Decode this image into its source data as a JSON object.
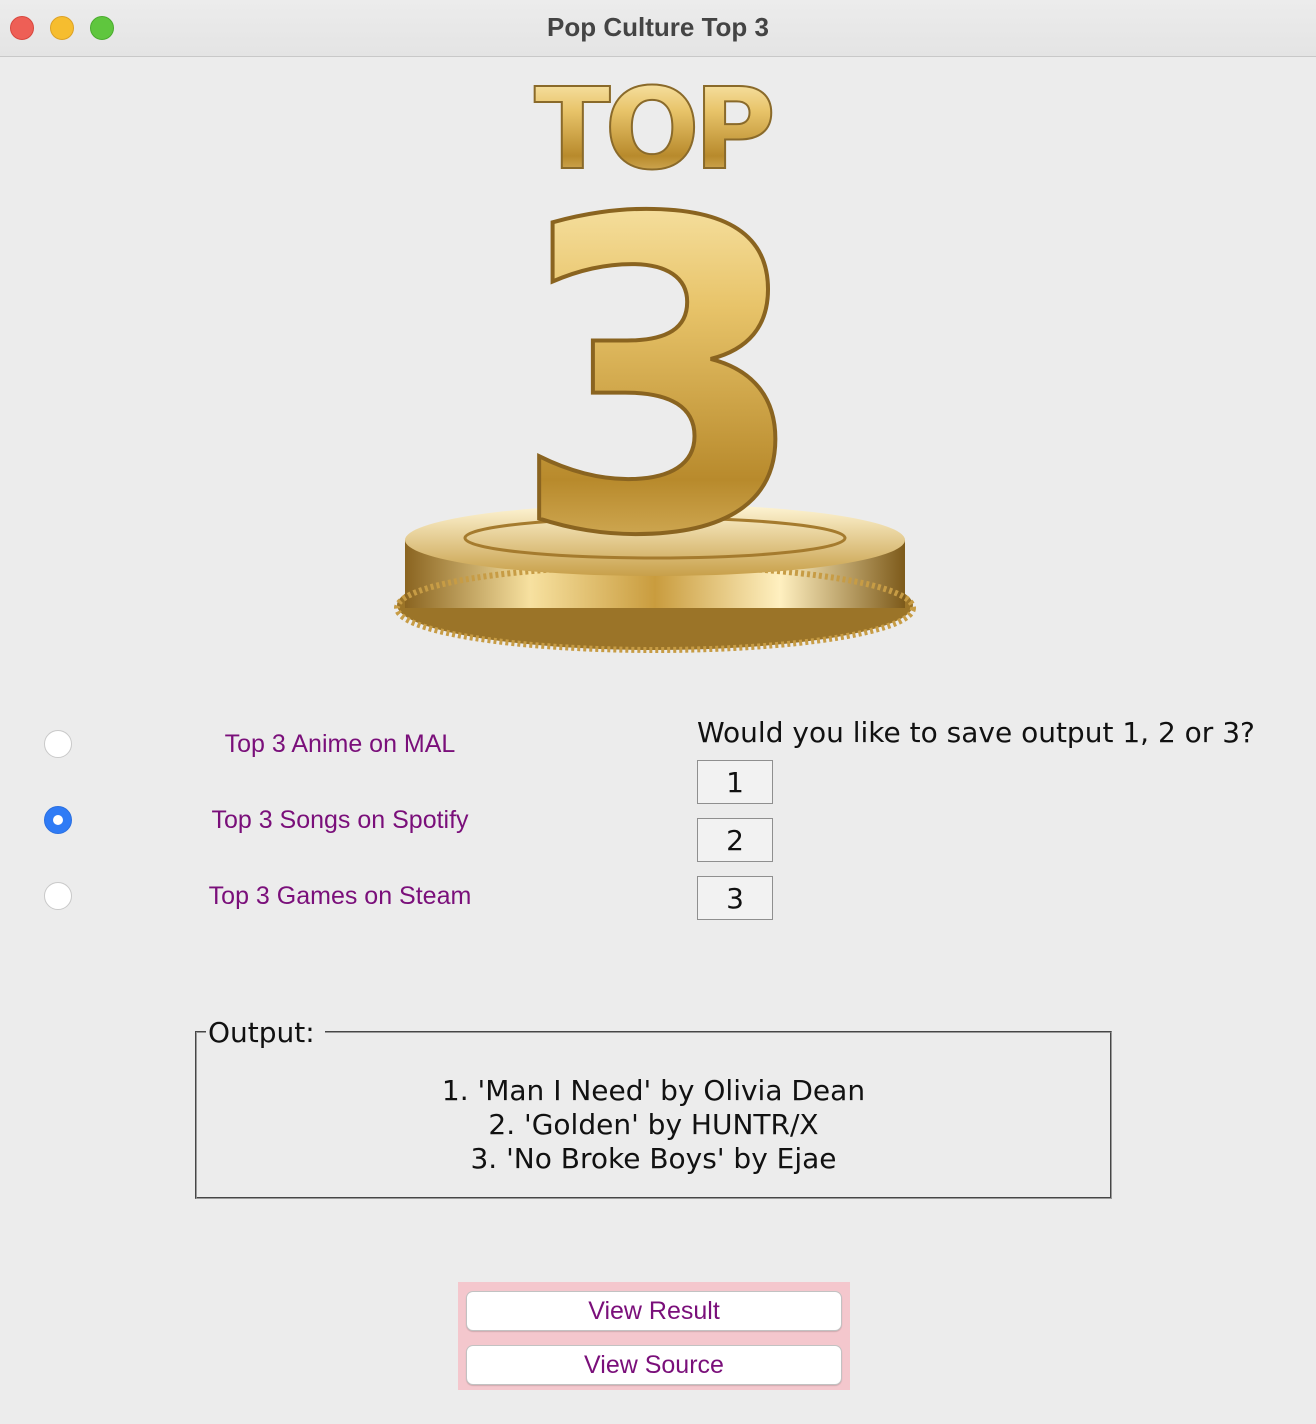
{
  "window": {
    "title": "Pop Culture Top 3",
    "controls": [
      "close",
      "minimize",
      "maximize"
    ]
  },
  "logo": {
    "icon": "gold-top-3-trophy-logo",
    "text_top": "TOP",
    "text_number": "3"
  },
  "categories": {
    "selected_index": 1,
    "items": [
      {
        "label": "Top 3 Anime on MAL",
        "checked": false
      },
      {
        "label": "Top 3 Songs on Spotify",
        "checked": true
      },
      {
        "label": "Top 3 Games on Steam",
        "checked": false
      }
    ]
  },
  "save": {
    "question": "Would you like to save output 1, 2 or 3?",
    "buttons": [
      "1",
      "2",
      "3"
    ]
  },
  "output": {
    "legend": "Output:",
    "lines": [
      "1. 'Man I Need' by Olivia Dean",
      "2. 'Golden' by HUNTR/X",
      "3. 'No Broke Boys' by Ejae"
    ]
  },
  "actions": {
    "view_result": "View Result",
    "view_source": "View Source"
  },
  "colors": {
    "label_purple": "#7a0f7a",
    "button_panel_pink": "#f4c7cd",
    "radio_selected_blue": "#2f7bf5",
    "gold": "#d9b45a"
  }
}
